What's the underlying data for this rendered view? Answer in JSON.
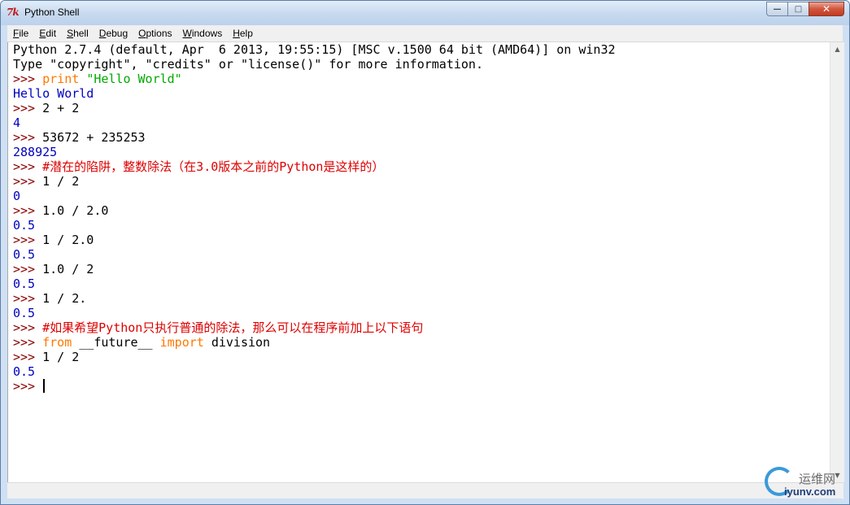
{
  "window": {
    "title": "Python Shell",
    "icon": "tk-feather-icon"
  },
  "menu": [
    "File",
    "Edit",
    "Shell",
    "Debug",
    "Options",
    "Windows",
    "Help"
  ],
  "colors": {
    "prompt": "#8b0000",
    "stdout": "#0000c0",
    "keyword": "#ff7700",
    "string": "#00aa00",
    "comment": "#dd0000"
  },
  "console": [
    [
      {
        "t": "Python 2.7.4 (default, Apr  6 2013, 19:55:15) [MSC v.1500 64 bit (AMD64)] on win32",
        "c": "plain"
      }
    ],
    [
      {
        "t": "Type \"copyright\", \"credits\" or \"license()\" for more information.",
        "c": "plain"
      }
    ],
    [
      {
        "t": ">>> ",
        "c": "prompt"
      },
      {
        "t": "print",
        "c": "kw"
      },
      {
        "t": " ",
        "c": "plain"
      },
      {
        "t": "\"Hello World\"",
        "c": "str"
      }
    ],
    [
      {
        "t": "Hello World",
        "c": "stdout"
      }
    ],
    [
      {
        "t": ">>> ",
        "c": "prompt"
      },
      {
        "t": "2 + 2",
        "c": "plain"
      }
    ],
    [
      {
        "t": "4",
        "c": "stdout"
      }
    ],
    [
      {
        "t": ">>> ",
        "c": "prompt"
      },
      {
        "t": "53672 + 235253",
        "c": "plain"
      }
    ],
    [
      {
        "t": "288925",
        "c": "stdout"
      }
    ],
    [
      {
        "t": ">>> ",
        "c": "prompt"
      },
      {
        "t": "#潜在的陷阱，整数除法（在3.0版本之前的Python是这样的）",
        "c": "comment"
      }
    ],
    [
      {
        "t": ">>> ",
        "c": "prompt"
      },
      {
        "t": "1 / 2",
        "c": "plain"
      }
    ],
    [
      {
        "t": "0",
        "c": "stdout"
      }
    ],
    [
      {
        "t": ">>> ",
        "c": "prompt"
      },
      {
        "t": "1.0 / 2.0",
        "c": "plain"
      }
    ],
    [
      {
        "t": "0.5",
        "c": "stdout"
      }
    ],
    [
      {
        "t": ">>> ",
        "c": "prompt"
      },
      {
        "t": "1 / 2.0",
        "c": "plain"
      }
    ],
    [
      {
        "t": "0.5",
        "c": "stdout"
      }
    ],
    [
      {
        "t": ">>> ",
        "c": "prompt"
      },
      {
        "t": "1.0 / 2",
        "c": "plain"
      }
    ],
    [
      {
        "t": "0.5",
        "c": "stdout"
      }
    ],
    [
      {
        "t": ">>> ",
        "c": "prompt"
      },
      {
        "t": "1 / 2.",
        "c": "plain"
      }
    ],
    [
      {
        "t": "0.5",
        "c": "stdout"
      }
    ],
    [
      {
        "t": ">>> ",
        "c": "prompt"
      },
      {
        "t": "#如果希望Python只执行普通的除法，那么可以在程序前加上以下语句",
        "c": "comment"
      }
    ],
    [
      {
        "t": ">>> ",
        "c": "prompt"
      },
      {
        "t": "from",
        "c": "kw"
      },
      {
        "t": " __future__ ",
        "c": "plain"
      },
      {
        "t": "import",
        "c": "kw"
      },
      {
        "t": " division",
        "c": "plain"
      }
    ],
    [
      {
        "t": ">>> ",
        "c": "prompt"
      },
      {
        "t": "1 / 2",
        "c": "plain"
      }
    ],
    [
      {
        "t": "0.5",
        "c": "stdout"
      }
    ],
    [
      {
        "t": ">>> ",
        "c": "prompt"
      }
    ]
  ],
  "watermark": {
    "cn": "运维网",
    "url": "iyunv.com"
  }
}
